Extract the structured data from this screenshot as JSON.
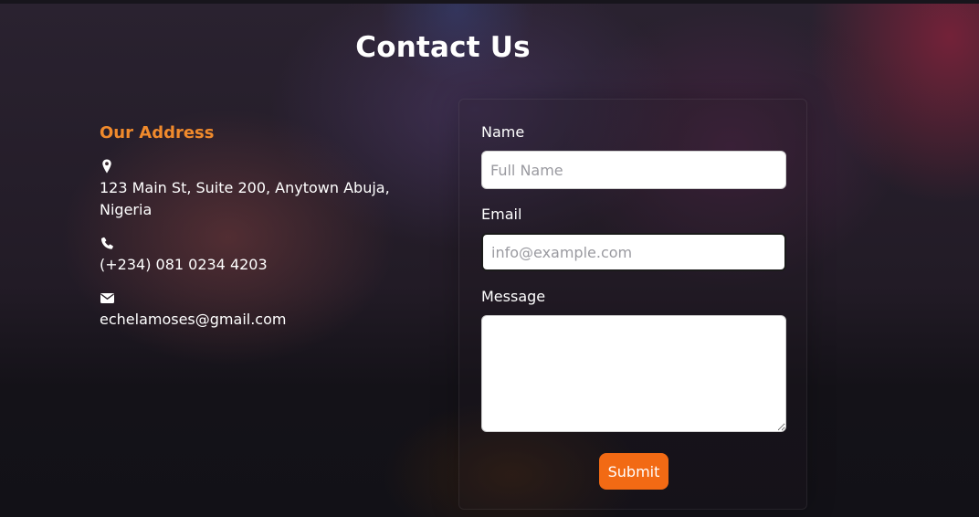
{
  "page": {
    "title": "Contact Us"
  },
  "address": {
    "heading": "Our Address",
    "heading_color": "#f08a2c",
    "items": [
      {
        "icon": "map-marker-icon",
        "text": "123 Main St, Suite 200, Anytown Abuja, Nigeria"
      },
      {
        "icon": "phone-icon",
        "text": "(+234) 081 0234 4203"
      },
      {
        "icon": "envelope-icon",
        "text": "echelamoses@gmail.com"
      }
    ]
  },
  "form": {
    "name_label": "Name",
    "name_placeholder": "Full Name",
    "name_value": "",
    "email_label": "Email",
    "email_placeholder": "info@example.com",
    "email_value": "",
    "message_label": "Message",
    "message_value": "",
    "submit_label": "Submit",
    "submit_color": "#f26a14"
  }
}
